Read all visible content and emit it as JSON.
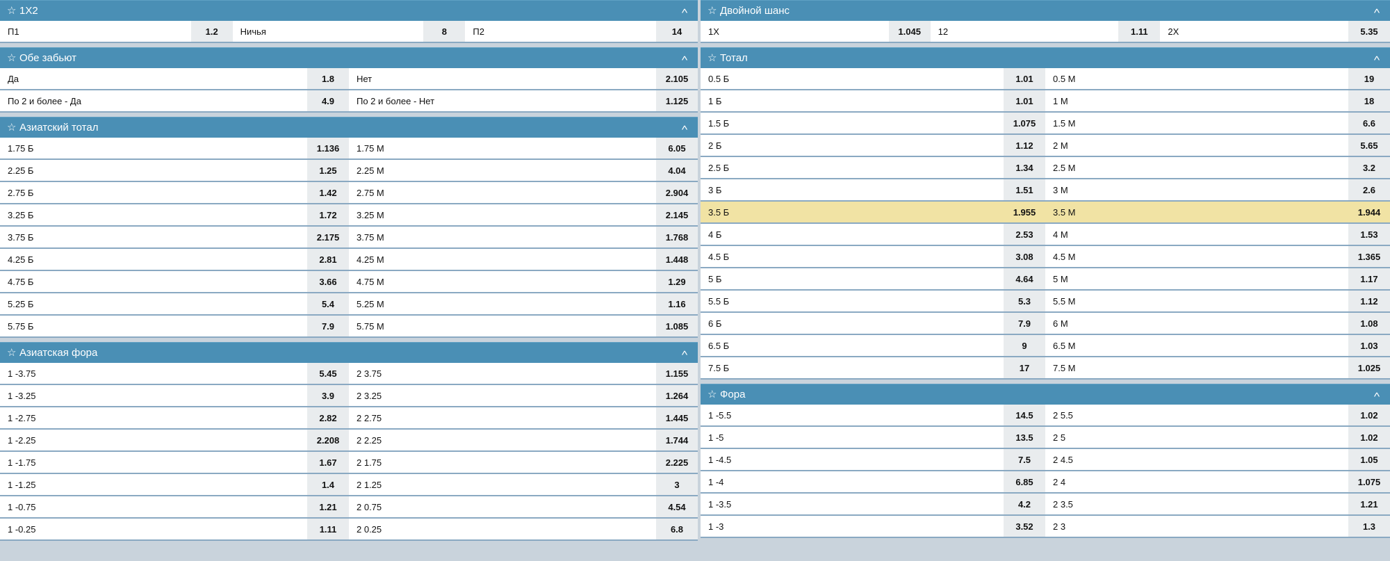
{
  "left": [
    {
      "title": "1X2",
      "rows": [
        [
          [
            "П1",
            "1.2"
          ],
          [
            "Ничья",
            "8"
          ],
          [
            "П2",
            "14"
          ]
        ]
      ]
    },
    {
      "title": "Обе забьют",
      "rows": [
        [
          [
            "Да",
            "1.8"
          ],
          [
            "Нет",
            "2.105"
          ]
        ],
        [
          [
            "По 2 и более - Да",
            "4.9"
          ],
          [
            "По 2 и более - Нет",
            "1.125"
          ]
        ]
      ]
    },
    {
      "title": "Азиатский тотал",
      "rows": [
        [
          [
            "1.75 Б",
            "1.136"
          ],
          [
            "1.75 М",
            "6.05"
          ]
        ],
        [
          [
            "2.25 Б",
            "1.25"
          ],
          [
            "2.25 М",
            "4.04"
          ]
        ],
        [
          [
            "2.75 Б",
            "1.42"
          ],
          [
            "2.75 М",
            "2.904"
          ]
        ],
        [
          [
            "3.25 Б",
            "1.72"
          ],
          [
            "3.25 М",
            "2.145"
          ]
        ],
        [
          [
            "3.75 Б",
            "2.175"
          ],
          [
            "3.75 М",
            "1.768"
          ]
        ],
        [
          [
            "4.25 Б",
            "2.81"
          ],
          [
            "4.25 М",
            "1.448"
          ]
        ],
        [
          [
            "4.75 Б",
            "3.66"
          ],
          [
            "4.75 М",
            "1.29"
          ]
        ],
        [
          [
            "5.25 Б",
            "5.4"
          ],
          [
            "5.25 М",
            "1.16"
          ]
        ],
        [
          [
            "5.75 Б",
            "7.9"
          ],
          [
            "5.75 М",
            "1.085"
          ]
        ]
      ]
    },
    {
      "title": "Азиатская фора",
      "rows": [
        [
          [
            "1 -3.75",
            "5.45"
          ],
          [
            "2 3.75",
            "1.155"
          ]
        ],
        [
          [
            "1 -3.25",
            "3.9"
          ],
          [
            "2 3.25",
            "1.264"
          ]
        ],
        [
          [
            "1 -2.75",
            "2.82"
          ],
          [
            "2 2.75",
            "1.445"
          ]
        ],
        [
          [
            "1 -2.25",
            "2.208"
          ],
          [
            "2 2.25",
            "1.744"
          ]
        ],
        [
          [
            "1 -1.75",
            "1.67"
          ],
          [
            "2 1.75",
            "2.225"
          ]
        ],
        [
          [
            "1 -1.25",
            "1.4"
          ],
          [
            "2 1.25",
            "3"
          ]
        ],
        [
          [
            "1 -0.75",
            "1.21"
          ],
          [
            "2 0.75",
            "4.54"
          ]
        ],
        [
          [
            "1 -0.25",
            "1.11"
          ],
          [
            "2 0.25",
            "6.8"
          ]
        ]
      ]
    }
  ],
  "right": [
    {
      "title": "Двойной шанс",
      "rows": [
        [
          [
            "1X",
            "1.045"
          ],
          [
            "12",
            "1.11"
          ],
          [
            "2X",
            "5.35"
          ]
        ]
      ]
    },
    {
      "title": "Тотал",
      "highlight_row": 6,
      "rows": [
        [
          [
            "0.5 Б",
            "1.01"
          ],
          [
            "0.5 М",
            "19"
          ]
        ],
        [
          [
            "1 Б",
            "1.01"
          ],
          [
            "1 М",
            "18"
          ]
        ],
        [
          [
            "1.5 Б",
            "1.075"
          ],
          [
            "1.5 М",
            "6.6"
          ]
        ],
        [
          [
            "2 Б",
            "1.12"
          ],
          [
            "2 М",
            "5.65"
          ]
        ],
        [
          [
            "2.5 Б",
            "1.34"
          ],
          [
            "2.5 М",
            "3.2"
          ]
        ],
        [
          [
            "3 Б",
            "1.51"
          ],
          [
            "3 М",
            "2.6"
          ]
        ],
        [
          [
            "3.5 Б",
            "1.955"
          ],
          [
            "3.5 М",
            "1.944"
          ]
        ],
        [
          [
            "4 Б",
            "2.53"
          ],
          [
            "4 М",
            "1.53"
          ]
        ],
        [
          [
            "4.5 Б",
            "3.08"
          ],
          [
            "4.5 М",
            "1.365"
          ]
        ],
        [
          [
            "5 Б",
            "4.64"
          ],
          [
            "5 М",
            "1.17"
          ]
        ],
        [
          [
            "5.5 Б",
            "5.3"
          ],
          [
            "5.5 М",
            "1.12"
          ]
        ],
        [
          [
            "6 Б",
            "7.9"
          ],
          [
            "6 М",
            "1.08"
          ]
        ],
        [
          [
            "6.5 Б",
            "9"
          ],
          [
            "6.5 М",
            "1.03"
          ]
        ],
        [
          [
            "7.5 Б",
            "17"
          ],
          [
            "7.5 М",
            "1.025"
          ]
        ]
      ]
    },
    {
      "title": "Фора",
      "rows": [
        [
          [
            "1 -5.5",
            "14.5"
          ],
          [
            "2 5.5",
            "1.02"
          ]
        ],
        [
          [
            "1 -5",
            "13.5"
          ],
          [
            "2 5",
            "1.02"
          ]
        ],
        [
          [
            "1 -4.5",
            "7.5"
          ],
          [
            "2 4.5",
            "1.05"
          ]
        ],
        [
          [
            "1 -4",
            "6.85"
          ],
          [
            "2 4",
            "1.075"
          ]
        ],
        [
          [
            "1 -3.5",
            "4.2"
          ],
          [
            "2 3.5",
            "1.21"
          ]
        ],
        [
          [
            "1 -3",
            "3.52"
          ],
          [
            "2 3",
            "1.3"
          ]
        ]
      ]
    }
  ],
  "icons": {
    "star": "star-outline-icon",
    "collapse": "chevron-up-icon"
  },
  "colors": {
    "header": "#4a8fb5",
    "highlight": "#f1e3a4",
    "odd_bg": "#e9ecee",
    "separator": "#8aa9c2"
  }
}
